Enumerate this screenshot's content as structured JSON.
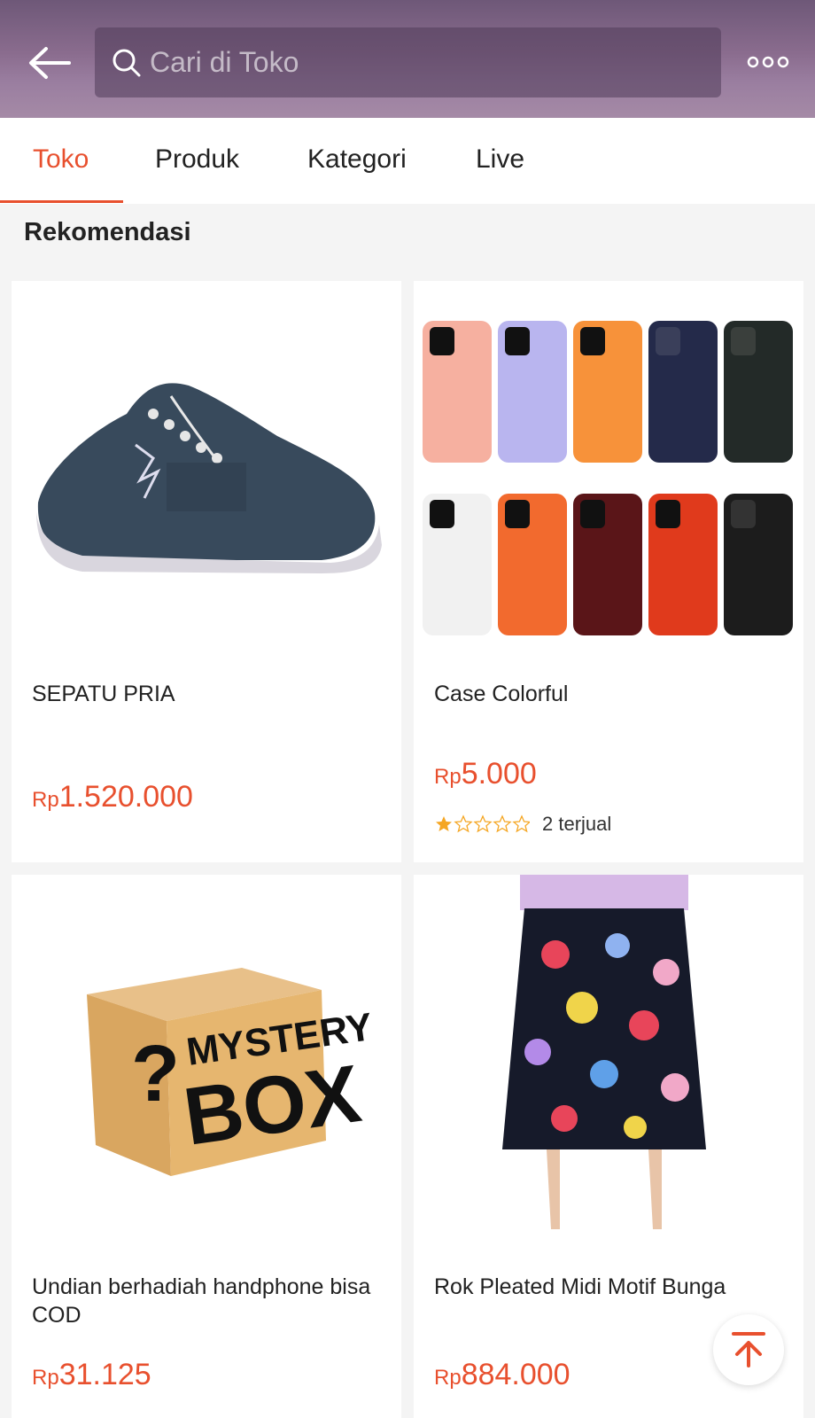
{
  "header": {
    "search_placeholder": "Cari di Toko"
  },
  "tabs": [
    {
      "label": "Toko",
      "active": true
    },
    {
      "label": "Produk",
      "active": false
    },
    {
      "label": "Kategori",
      "active": false
    },
    {
      "label": "Live",
      "active": false
    }
  ],
  "section": {
    "title": "Rekomendasi"
  },
  "products": [
    {
      "name": "SEPATU PRIA",
      "currency": "Rp",
      "price": "1.520.000"
    },
    {
      "name": "Case Colorful",
      "currency": "Rp",
      "price": "5.000",
      "rating_stars": 1,
      "sold": "2 terjual"
    },
    {
      "name": "Undian berhadiah handphone bisa COD",
      "currency": "Rp",
      "price": "31.125",
      "image_text": {
        "line1": "MYSTERY",
        "line2": "BOX",
        "mark": "?"
      }
    },
    {
      "name": "Rok Pleated Midi Motif Bunga",
      "currency": "Rp",
      "price": "884.000"
    }
  ],
  "colors": {
    "accent": "#e8502e",
    "star": "#f5a623"
  },
  "icons": {
    "back": "arrow-left-icon",
    "search": "search-icon",
    "more": "more-dots-icon",
    "scroll_top": "arrow-up-to-top-icon"
  }
}
